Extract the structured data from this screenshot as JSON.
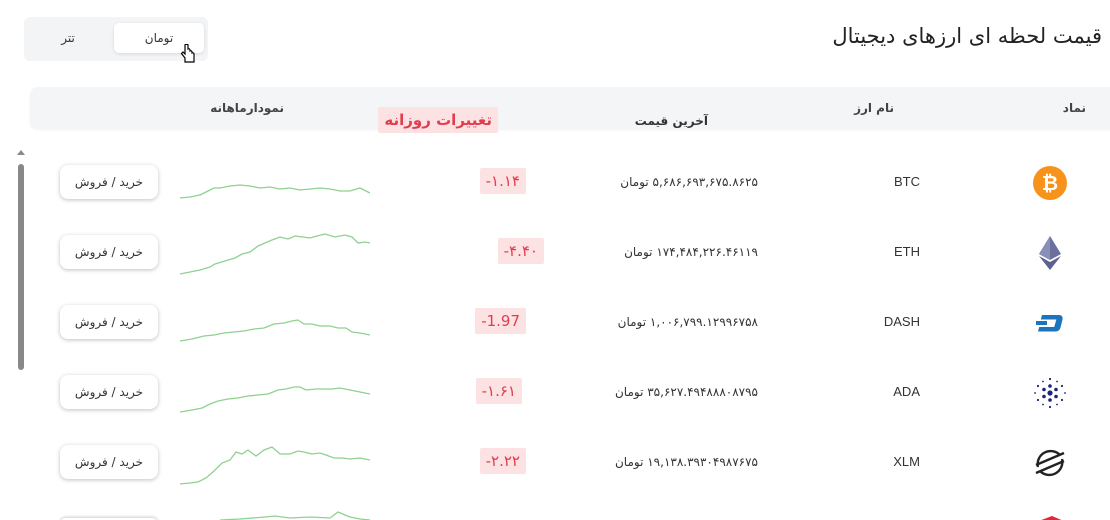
{
  "header": {
    "title": "قیمت لحظه ای ارزهای دیجیتال"
  },
  "currency_toggle": {
    "options": [
      "تتر",
      "تومان"
    ],
    "selected": "تومان"
  },
  "table": {
    "columns": {
      "symbol": "نماد",
      "name": "نام ارز",
      "price": "آخرین قیمت",
      "change": "تغییرات روزانه",
      "chart": "نمودارماهانه"
    },
    "rows": [
      {
        "icon": "bitcoin-icon",
        "symbol": "BTC",
        "price": "۵,۶۸۶,۶۹۳,۶۷۵.۸۶۲۵ تومان",
        "change": "-۱.۱۴",
        "button": "خرید / فروش",
        "color": "#f7931a"
      },
      {
        "icon": "ethereum-icon",
        "symbol": "ETH",
        "price": "۱۷۴,۴۸۴,۲۲۶.۴۶۱۱۹ تومان",
        "change": "-۴.۴۰",
        "button": "خرید / فروش",
        "color": "#6a6f9c"
      },
      {
        "icon": "dash-icon",
        "symbol": "DASH",
        "price": "۱,۰۰۶,۷۹۹.۱۲۹۹۶۷۵۸ تومان",
        "change": "-1.97",
        "button": "خرید / فروش",
        "color": "#1c75bc"
      },
      {
        "icon": "cardano-icon",
        "symbol": "ADA",
        "price": "۳۵,۶۲۷.۴۹۴۸۸۸۰۸۷۹۵ تومان",
        "change": "-۱.۶۱",
        "button": "خرید / فروش",
        "color": "#1a237e"
      },
      {
        "icon": "stellar-icon",
        "symbol": "XLM",
        "price": "۱۹,۱۳۸.۳۹۳۰۴۹۸۷۶۷۵ تومان",
        "change": "-۲.۲۲",
        "button": "خرید / فروش",
        "color": "#222222"
      }
    ]
  },
  "colors": {
    "spark_line": "#8fd18f",
    "change_bg": "#fde2e4",
    "change_text": "#e03e4e"
  }
}
